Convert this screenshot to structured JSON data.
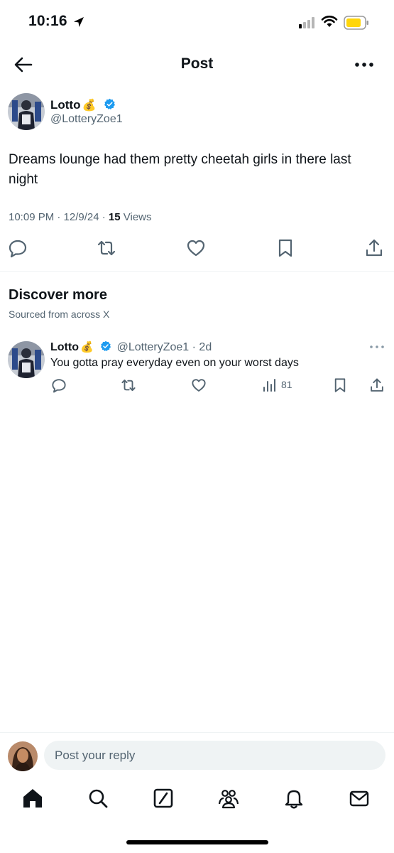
{
  "status_bar": {
    "time": "10:16"
  },
  "header": {
    "title": "Post"
  },
  "post": {
    "author_name": "Lotto",
    "author_emoji": "💰",
    "handle": "@LotteryZoe1",
    "text": "Dreams lounge had them pretty cheetah girls in there last night",
    "timestamp": "10:09 PM · 12/9/24 · ",
    "views_count": "15",
    "views_label": " Views"
  },
  "discover": {
    "title": "Discover more",
    "subtitle": "Sourced from across X",
    "items": [
      {
        "author_name": "Lotto",
        "author_emoji": "💰",
        "handle_time": "@LotteryZoe1 · 2d",
        "text": "You gotta pray everyday even on your worst days",
        "views": "81"
      }
    ]
  },
  "reply": {
    "placeholder": "Post your reply"
  },
  "icons": [
    "back-arrow-icon",
    "more-icon",
    "reply-icon",
    "repost-icon",
    "like-icon",
    "bookmark-icon",
    "share-icon",
    "views-icon",
    "home-icon",
    "search-icon",
    "grok-icon",
    "communities-icon",
    "notifications-icon",
    "messages-icon"
  ],
  "colors": {
    "verified": "#1d9bf0",
    "text": "#0f1419",
    "secondary": "#536471",
    "battery": "#ffd60a"
  }
}
